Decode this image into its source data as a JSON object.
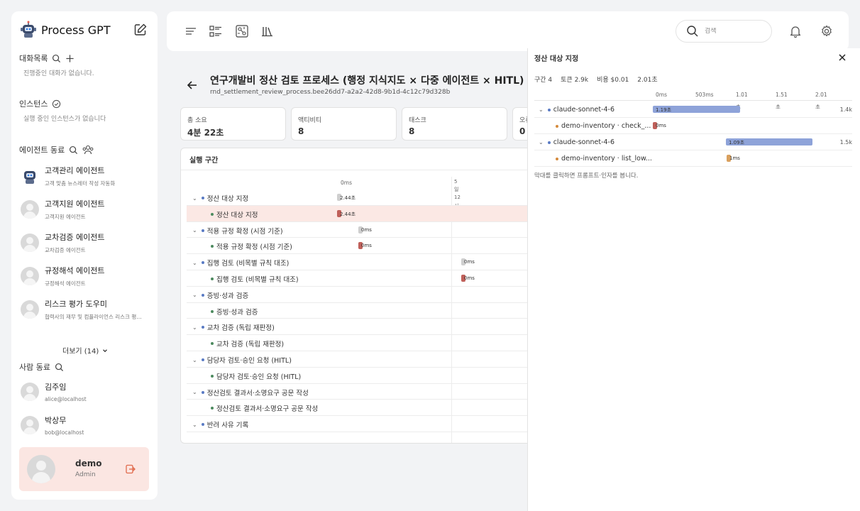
{
  "app": {
    "name": "Process GPT"
  },
  "sidebar": {
    "conversations": {
      "title": "대화목록",
      "empty": "진행중인 대화가 없습니다."
    },
    "instances": {
      "title": "인스턴스",
      "empty": "실행 중인 인스턴스가 없습니다"
    },
    "agents": {
      "title": "에이전트 동료",
      "items": [
        {
          "name": "고객관리 에이전트",
          "desc": "고객 맞춤 뉴스레터 작성 자동화"
        },
        {
          "name": "고객지원 에이전트",
          "desc": "고객지원 에이전트"
        },
        {
          "name": "교차검증 에이전트",
          "desc": "교차검증 에이전트"
        },
        {
          "name": "규정해석 에이전트",
          "desc": "규정해석 에이전트"
        },
        {
          "name": "리스크 평가 도우미",
          "desc": "협력사의 재무 및 컴플라이언스 리스크 평가 ..."
        }
      ],
      "more": "더보기 (14)"
    },
    "people": {
      "title": "사람 동료",
      "items": [
        {
          "name": "김주임",
          "email": "alice@localhost"
        },
        {
          "name": "박상무",
          "email": "bob@localhost"
        }
      ]
    },
    "user": {
      "name": "demo",
      "role": "Admin"
    }
  },
  "topbar": {
    "search_placeholder": "검색"
  },
  "process": {
    "title": "연구개발비 정산 검토 프로세스 (행정 지식지도 × 다중 에이전트 × HITL)",
    "subtitle": "rnd_settlement_review_process.bee26dd7-a2a2-42d8-9b1d-4c12c79d328b",
    "stats": [
      {
        "label": "총 소요",
        "value": "4분 22초"
      },
      {
        "label": "액티비티",
        "value": "8"
      },
      {
        "label": "태스크",
        "value": "8"
      },
      {
        "label": "오류",
        "value": "0"
      }
    ]
  },
  "execution": {
    "title": "실행 구간",
    "ticks": [
      "0ms",
      "5",
      "일",
      "12",
      "시",
      "간"
    ],
    "rows": [
      {
        "label": "정산 대상 지정",
        "level": 0,
        "bar_label": "2.44초"
      },
      {
        "label": "정산 대상 지정",
        "level": 1,
        "bar_label": "2.44초",
        "highlight": true
      },
      {
        "label": "적용 규정 확정 (시점 기준)",
        "level": 0,
        "bar_label": "0ms"
      },
      {
        "label": "적용 규정 확정 (시점 기준)",
        "level": 1,
        "bar_label": "0ms"
      },
      {
        "label": "집행 검토 (비목별 규칙 대조)",
        "level": 0,
        "bar_label": "0ms"
      },
      {
        "label": "집행 검토 (비목별 규칙 대조)",
        "level": 1,
        "bar_label": "0ms"
      },
      {
        "label": "증빙·성과 검증",
        "level": 0,
        "bar_label": ""
      },
      {
        "label": "증빙·성과 검증",
        "level": 1,
        "bar_label": ""
      },
      {
        "label": "교차 검증 (독립 재판정)",
        "level": 0,
        "bar_label": ""
      },
      {
        "label": "교차 검증 (독립 재판정)",
        "level": 1,
        "bar_label": ""
      },
      {
        "label": "담당자 검토·승인 요청 (HITL)",
        "level": 0,
        "bar_label": ""
      },
      {
        "label": "담당자 검토·승인 요청 (HITL)",
        "level": 1,
        "bar_label": ""
      },
      {
        "label": "정산검토 결과서·소명요구 공문 작성",
        "level": 0,
        "bar_label": ""
      },
      {
        "label": "정산검토 결과서·소명요구 공문 작성",
        "level": 1,
        "bar_label": ""
      },
      {
        "label": "반려 사유 기록",
        "level": 0,
        "bar_label": ""
      }
    ]
  },
  "detail": {
    "title": "정산 대상 지정",
    "stats": [
      "구간 4",
      "토큰 2.9k",
      "비용 $0.01",
      "2.01초"
    ],
    "ticks": [
      "0ms",
      "503ms",
      "1.01",
      "1.51",
      "2.01"
    ],
    "tick_suffix": "초",
    "rows": [
      {
        "label": "claude-sonnet-4-6",
        "level": 0,
        "bar_label": "1.19초",
        "value": "1.4k"
      },
      {
        "label": "demo-inventory · check_...",
        "level": 1,
        "bar_label": "0ms",
        "value": ""
      },
      {
        "label": "claude-sonnet-4-6",
        "level": 0,
        "bar_label": "1.09초",
        "value": "1.5k"
      },
      {
        "label": "demo-inventory · list_low...",
        "level": 1,
        "bar_label": "1ms",
        "value": ""
      }
    ],
    "hint": "막대를 클릭하면 프롬프트·인자를 봅니다."
  },
  "colors": {
    "accent_bar": "#8ea3d9",
    "red_bar": "#c0605a",
    "gray_bar": "#cfcfcf",
    "highlight_row": "#fbe8e4",
    "user_card": "#fbe6e2",
    "dot_blue": "#5a7bc4",
    "dot_green": "#4c8a5e",
    "dot_orange": "#d58a3c"
  }
}
